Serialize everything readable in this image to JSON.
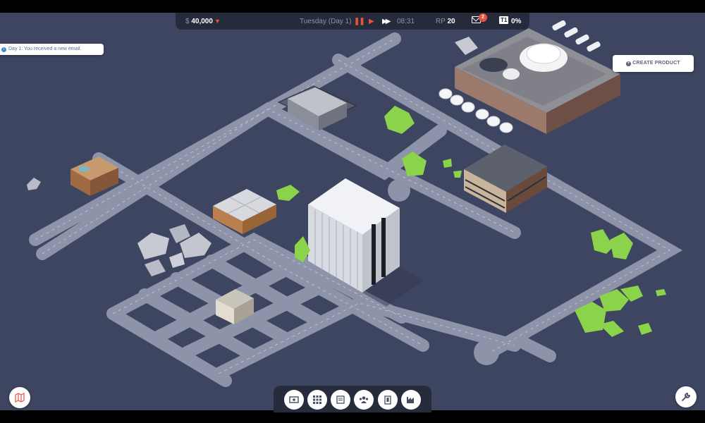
{
  "hud": {
    "currency": "$",
    "money": "40,000",
    "money_trend_icon": "chevron-down-icon",
    "day_label": "Tuesday (Day 1)",
    "time": "08:31",
    "rp_label": "RP",
    "rp_value": "20",
    "mail_badge": "2",
    "tier": "T1",
    "percent": "0%"
  },
  "notification": {
    "text": "Day 1: You received a new email."
  },
  "actions": {
    "create_product": "CREATE PRODUCT"
  },
  "toolbar": [
    {
      "name": "finance-icon"
    },
    {
      "name": "grid-icon"
    },
    {
      "name": "products-icon"
    },
    {
      "name": "employees-icon"
    },
    {
      "name": "building-icon"
    },
    {
      "name": "factory-icon"
    }
  ],
  "corner_buttons": {
    "left": "map-icon",
    "right": "wrench-icon"
  },
  "colors": {
    "background": "#3e4560",
    "road": "#8d93a8",
    "accent": "#e8523a",
    "tree": "#8bd34a"
  }
}
